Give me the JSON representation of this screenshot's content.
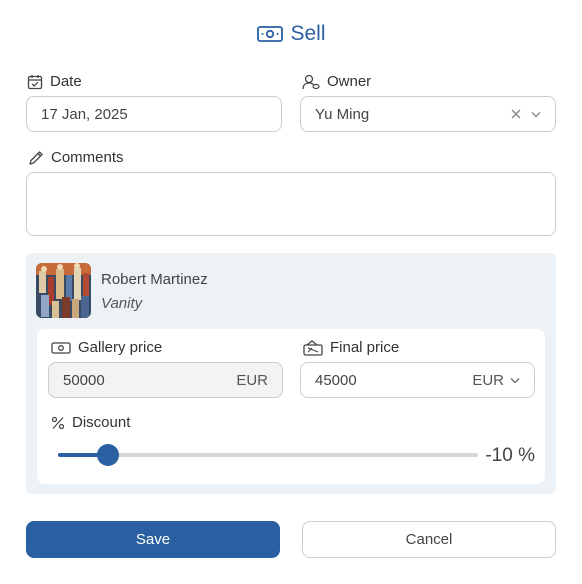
{
  "header": {
    "title": "Sell",
    "icon": "cash-icon"
  },
  "form": {
    "date": {
      "label": "Date",
      "value": "17 Jan, 2025"
    },
    "owner": {
      "label": "Owner",
      "value": "Yu Ming"
    },
    "comments": {
      "label": "Comments",
      "value": ""
    }
  },
  "artwork": {
    "artist": "Robert Martinez",
    "title": "Vanity"
  },
  "pricing": {
    "gallery": {
      "label": "Gallery price",
      "value": "50000",
      "currency": "EUR"
    },
    "final": {
      "label": "Final price",
      "value": "45000",
      "currency": "EUR"
    },
    "discount": {
      "label": "Discount",
      "display": "-10 %",
      "value_percent": 10,
      "slider_fraction": 0.12
    }
  },
  "actions": {
    "save": "Save",
    "cancel": "Cancel"
  },
  "colors": {
    "accent": "#2a5fa1",
    "panel": "#edf2f7",
    "border": "#c9ccd1"
  }
}
